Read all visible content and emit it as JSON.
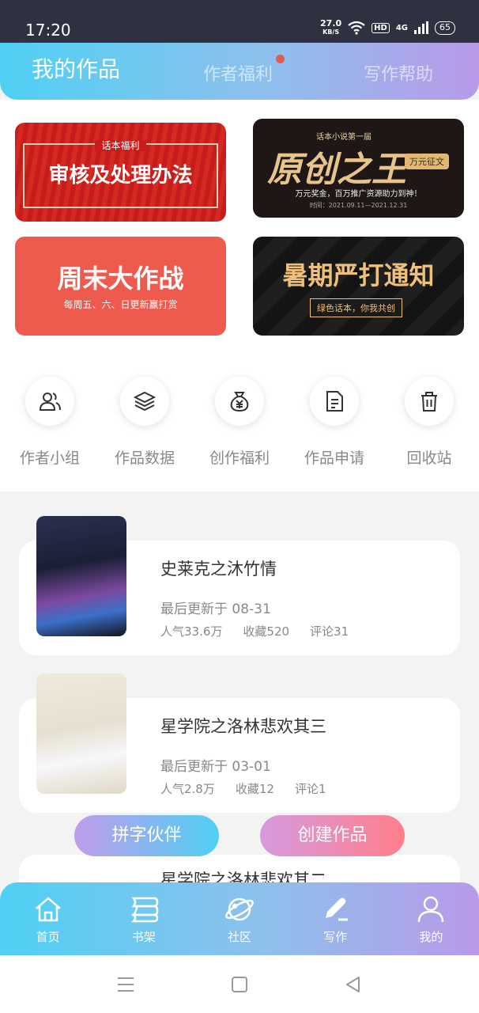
{
  "status_bar": {
    "time": "17:20",
    "net_speed": "27.0",
    "net_unit": "KB/S",
    "hd": "HD",
    "network": "4G",
    "battery": "65"
  },
  "header": {
    "tabs": [
      {
        "label": "我的作品"
      },
      {
        "label": "作者福利"
      },
      {
        "label": "写作帮助"
      }
    ]
  },
  "banners": [
    {
      "tag": "话本福利",
      "title": "审核及处理办法"
    },
    {
      "tag": "话本小说第一届",
      "title": "原创之王",
      "badge": "万元征文",
      "subtitle": "万元奖金，百万推广资源助力到神！",
      "date": "时间：2021.09.11—2021.12.31"
    },
    {
      "title": "周末大作战",
      "subtitle": "每周五、六、日更新赢打赏"
    },
    {
      "title": "暑期严打通知",
      "subtitle": "绿色话本，你我共创"
    }
  ],
  "quick_actions": [
    {
      "label": "作者小组",
      "icon": "author-group-icon"
    },
    {
      "label": "作品数据",
      "icon": "layers-icon"
    },
    {
      "label": "创作福利",
      "icon": "money-bag-icon"
    },
    {
      "label": "作品申请",
      "icon": "document-icon"
    },
    {
      "label": "回收站",
      "icon": "trash-icon"
    }
  ],
  "works": [
    {
      "title": "史莱克之沐竹情",
      "updated": "最后更新于 08-31",
      "popularity": "人气33.6万",
      "favorites": "收藏520",
      "comments": "评论31"
    },
    {
      "title": "星学院之洛林悲欢其三",
      "updated": "最后更新于 03-01",
      "popularity": "人气2.8万",
      "favorites": "收藏12",
      "comments": "评论1"
    },
    {
      "title": "星学院之洛林悲欢其二"
    }
  ],
  "fab": {
    "partner": "拼字伙伴",
    "create": "创建作品"
  },
  "tabbar": [
    {
      "label": "首页",
      "icon": "home-icon"
    },
    {
      "label": "书架",
      "icon": "bookshelf-icon"
    },
    {
      "label": "社区",
      "icon": "planet-icon"
    },
    {
      "label": "写作",
      "icon": "pen-icon"
    },
    {
      "label": "我的",
      "icon": "user-icon"
    }
  ],
  "colors": {
    "gradient_start": "#4fd0f4",
    "gradient_end": "#b89ae8",
    "red_dot": "#e65a4e"
  }
}
